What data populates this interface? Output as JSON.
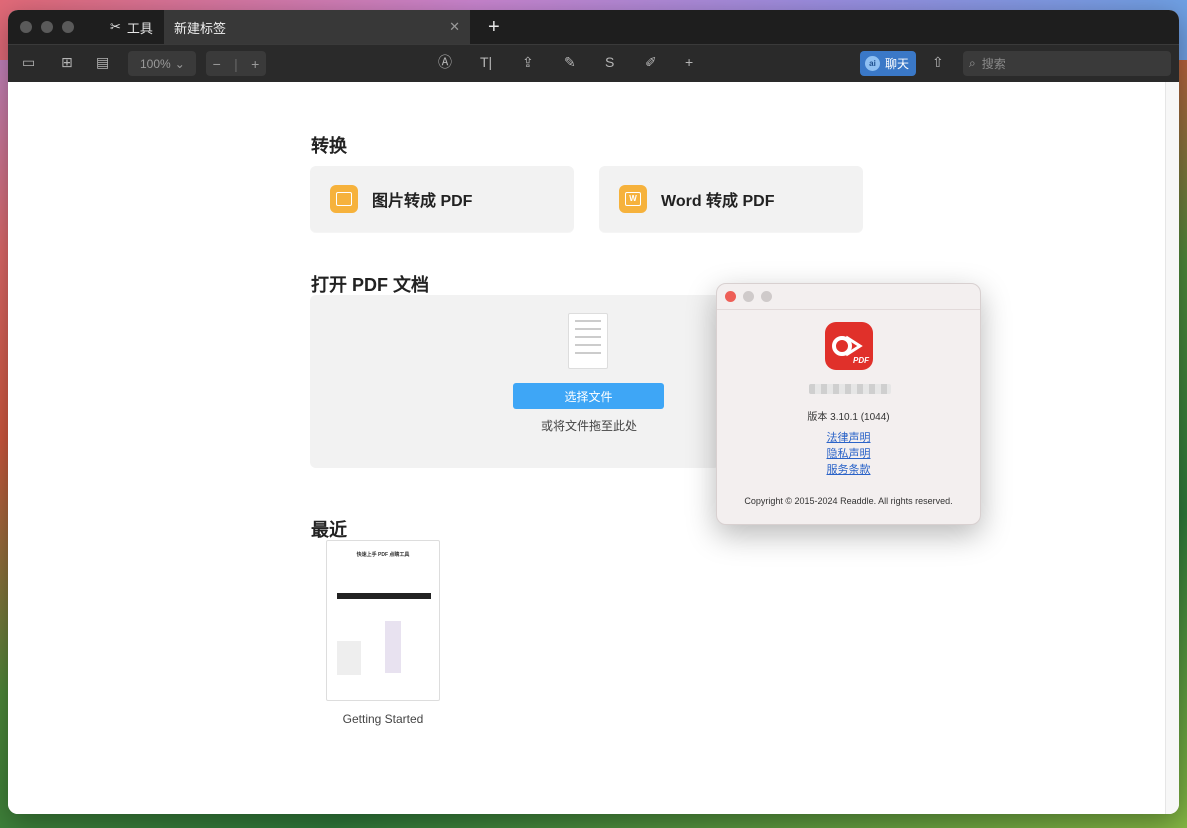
{
  "window": {
    "tabs": [
      {
        "label": "工具",
        "icon": "tools-icon"
      },
      {
        "label": "新建标签",
        "active": true
      }
    ],
    "close_tab_glyph": "✕",
    "new_tab_glyph": "+"
  },
  "toolbar": {
    "zoom": "100%",
    "zoom_out": "−",
    "zoom_in": "+",
    "chat_label": "聊天",
    "chat_badge": "ai",
    "search_placeholder": "搜索"
  },
  "main": {
    "convert_title": "转换",
    "convert_cards": [
      {
        "label": "图片转成 PDF",
        "icon": "image-icon"
      },
      {
        "label": "Word 转成 PDF",
        "icon": "word-icon",
        "badge": "W"
      }
    ],
    "open_title": "打开 PDF 文档",
    "choose_button": "选择文件",
    "drop_hint": "或将文件拖至此处",
    "recent_title": "最近",
    "recent_files": [
      {
        "label": "Getting Started",
        "thumb_title": "快速上手 PDF 点睛工具"
      }
    ]
  },
  "about": {
    "logo_text": "PDF",
    "version": "版本 3.10.1 (1044)",
    "links": [
      "法律声明",
      "隐私声明",
      "服务条款"
    ],
    "copyright": "Copyright © 2015-2024 Readdle. All rights reserved.",
    "traffic_colors": [
      "#ee5f57",
      "#cfcaca",
      "#cfcaca"
    ]
  },
  "colors": {
    "accent": "#3ea6f6",
    "card_icon": "#f6b23c",
    "logo": "#e0302a",
    "chat": "#3a78c7"
  }
}
